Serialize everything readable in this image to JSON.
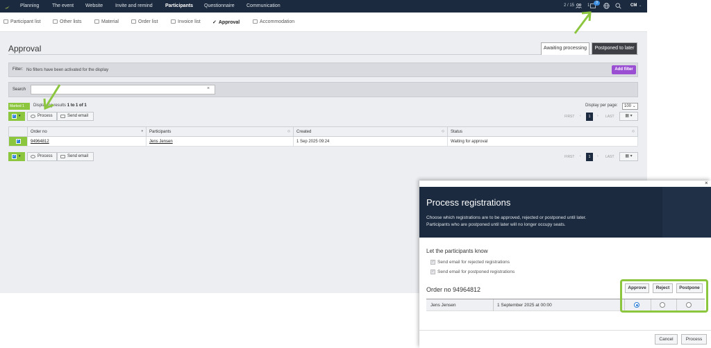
{
  "topnav": {
    "items": [
      "Planning",
      "The event",
      "Website",
      "Invite and remind",
      "Participants",
      "Questionnaire",
      "Communication"
    ],
    "active": "Participants",
    "seats": "2 / 15",
    "notifications": "1",
    "badge": "3",
    "user": "CM"
  },
  "subnav": {
    "items": [
      "Participant list",
      "Other lists",
      "Material",
      "Order list",
      "Invoice list",
      "Approval",
      "Accommodation"
    ],
    "active": "Approval"
  },
  "page": {
    "title": "Approval",
    "tabs": [
      "Awaiting processing",
      "Postponed to later"
    ]
  },
  "filter": {
    "label": "Filter:",
    "text": "No filters have been activated for the display",
    "add_button": "Add filter"
  },
  "search": {
    "label": "Search",
    "value": "",
    "clear": "×"
  },
  "list": {
    "marked": "Marked",
    "marked_count": "1",
    "results_prefix": "Displaying results",
    "results_range": "1 to 1 of 1",
    "per_page_label": "Display per page:",
    "per_page_value": "100",
    "process_button": "Process",
    "send_email_button": "Send email",
    "pager": {
      "first": "FIRST",
      "prev": "‹",
      "current": "1",
      "next": "›",
      "last": "LAST"
    },
    "columns": [
      "Order no",
      "Participants",
      "Created",
      "Status"
    ],
    "rows": [
      {
        "order_no": "94964812",
        "participant": "Jens Jensen",
        "created": "1 Sep 2025 09:24",
        "status": "Waiting for approval"
      }
    ]
  },
  "modal": {
    "title": "Process registrations",
    "desc_line1": "Choose which registrations are to be approved, rejected or postponed until later.",
    "desc_line2": "Participants who are postponed until later will no longer occupy seats.",
    "notify_heading": "Let the participants know",
    "check_rejected": "Send email for rejected registrations",
    "check_postponed": "Send email for postponed registrations",
    "order_heading": "Order no 94964812",
    "col_approve": "Approve",
    "col_reject": "Reject",
    "col_postpone": "Postpone",
    "reg_name": "Jens Jensen",
    "reg_date": "1 September 2025 at 00:00",
    "selected": "Approve",
    "cancel_button": "Cancel",
    "process_button": "Process",
    "close": "×"
  },
  "colors": {
    "nav_bg": "#1b2a3e",
    "accent_green": "#8cc63f",
    "accent_purple": "#9a4fd3",
    "checkbox_blue": "#2c7dd6"
  }
}
